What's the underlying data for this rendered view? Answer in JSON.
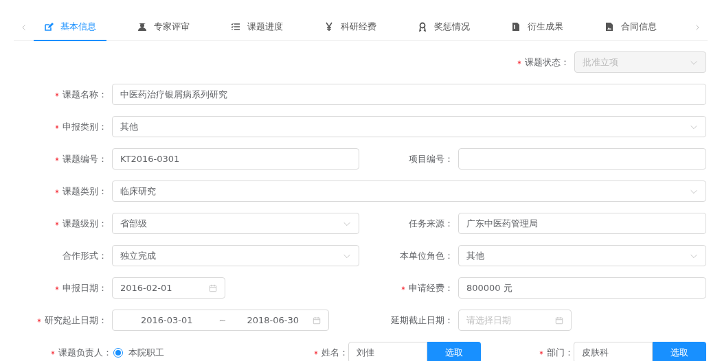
{
  "tabs": [
    {
      "label": "基本信息",
      "kind": "edit",
      "selected": true
    },
    {
      "label": "专家评审",
      "kind": "person",
      "selected": false
    },
    {
      "label": "课题进度",
      "kind": "list",
      "selected": false
    },
    {
      "label": "科研经费",
      "kind": "yen",
      "selected": false
    },
    {
      "label": "奖惩情况",
      "kind": "award",
      "selected": false
    },
    {
      "label": "衍生成果",
      "kind": "file",
      "selected": false
    },
    {
      "label": "合同信息",
      "kind": "image",
      "selected": false
    }
  ],
  "status_field": {
    "label": "课题状态",
    "required": true,
    "kind": "select",
    "value": "批准立项",
    "disabled": true
  },
  "rows": [
    [
      {
        "label": "课题名称",
        "required": true,
        "kind": "text",
        "value": "中医药治疗银屑病系列研究"
      }
    ],
    [
      {
        "label": "申报类别",
        "required": true,
        "kind": "select",
        "value": "其他"
      }
    ],
    [
      {
        "label": "课题编号",
        "required": true,
        "kind": "text",
        "value": "KT2016-0301"
      },
      {
        "label": "项目编号",
        "required": false,
        "kind": "text"
      }
    ],
    [
      {
        "label": "课题类别",
        "required": true,
        "kind": "select",
        "value": "临床研究"
      }
    ],
    [
      {
        "label": "课题级别",
        "required": true,
        "kind": "select",
        "value": "省部级"
      },
      {
        "label": "任务来源",
        "required": false,
        "kind": "text",
        "value": "广东中医药管理局"
      }
    ],
    [
      {
        "label": "合作形式",
        "required": false,
        "kind": "select",
        "value": "独立完成"
      },
      {
        "label": "本单位角色",
        "required": false,
        "kind": "select",
        "value": "其他"
      }
    ],
    [
      {
        "label": "申报日期",
        "required": true,
        "kind": "date",
        "value": "2016-02-01"
      },
      {
        "label": "申请经费",
        "required": true,
        "kind": "text",
        "value": "800000 元"
      }
    ],
    [
      {
        "label": "研究起止日期",
        "required": true,
        "kind": "range",
        "start": "2016-03-01",
        "separator": "~",
        "end": "2018-06-30"
      },
      {
        "label": "延期截止日期",
        "required": false,
        "kind": "date",
        "placeholder": "请选择日期"
      }
    ]
  ],
  "leader": {
    "label": "课题负责人",
    "required": true,
    "option": {
      "label": "本院职工",
      "selected": true
    },
    "name": {
      "label": "姓名",
      "required": true,
      "value": "刘佳",
      "button": "选取"
    },
    "department": {
      "label": "部门",
      "required": true,
      "value": "皮肤科",
      "button": "选取"
    }
  },
  "label_colon": "："
}
